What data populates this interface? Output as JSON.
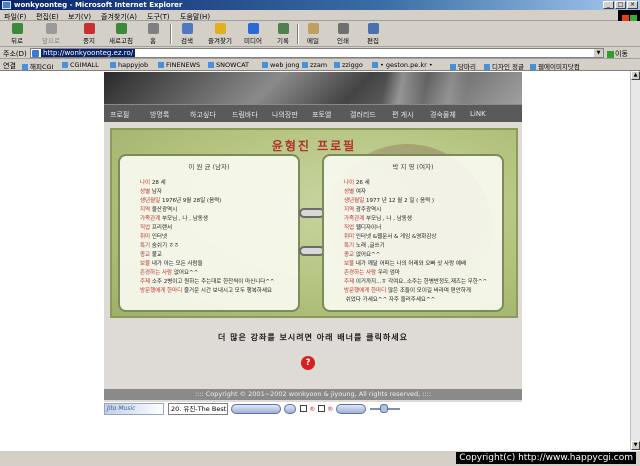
{
  "window": {
    "title": "wonkyoonteg - Microsoft Internet Explorer"
  },
  "menu": [
    "파일(F)",
    "편집(E)",
    "보기(V)",
    "즐겨찾기(A)",
    "도구(T)",
    "도움말(H)"
  ],
  "toolbar": {
    "back": "뒤로",
    "forward": "앞으로",
    "stop": "중지",
    "refresh": "새로고침",
    "home": "홈",
    "search": "검색",
    "favorites": "즐겨찾기",
    "media": "미디어",
    "history": "기록",
    "mail": "메일",
    "print": "인쇄",
    "edit": "편집"
  },
  "address": {
    "label": "주소(D)",
    "url": "http://wonkyoonteg.ez.ro/",
    "go": "이동"
  },
  "links": {
    "label": "연결",
    "items": [
      "해피CGI",
      "CGIMALL",
      "happyjob",
      "FINENEWS",
      "SNOWCAT",
      "web jong",
      "zzam",
      "zziggo",
      "• geston.pe.kr •",
      "당마리",
      "디자인 정글",
      "웹에이미지닷컴"
    ]
  },
  "site": {
    "nav": [
      "프로필",
      "방명록",
      "하고싶다",
      "드림바다",
      "나의장판",
      "포토앨",
      "갤러리드",
      "편 게시",
      "경숙물체",
      "LiNK"
    ],
    "profile_title": "윤형진 프로필",
    "left_name": "이 원 균 (남자)",
    "right_name": "박 지 영 (여자)",
    "left_rows": [
      {
        "k": "나이",
        "v": "28 세"
      },
      {
        "k": "성별",
        "v": "남자"
      },
      {
        "k": "생년월일",
        "v": "1976년 9월 28일 (음력)"
      },
      {
        "k": "지역",
        "v": "울산광역시"
      },
      {
        "k": "가족관계",
        "v": "부모님 , 나 , 남동생"
      },
      {
        "k": "직업",
        "v": "프리랜서"
      },
      {
        "k": "취미",
        "v": "인터넷"
      },
      {
        "k": "특기",
        "v": "숨쉬기 ㅎㅎ"
      },
      {
        "k": "종교",
        "v": "불교"
      },
      {
        "k": "보물",
        "v": "내가 아는 모든 사람들"
      },
      {
        "k": "존경하는 사람",
        "v": "없어요^^"
      },
      {
        "k": "주제",
        "v": "소주 2병이고 원하는 주는대로 한잔씩이 마신니다^^"
      },
      {
        "k": "방문했에게 한마디",
        "v": "즐거운 시간 보내시고 모두 행복하세요"
      }
    ],
    "right_rows": [
      {
        "k": "나이",
        "v": "26 세"
      },
      {
        "k": "성별",
        "v": "여자"
      },
      {
        "k": "생년월일",
        "v": "1977 년 12 월 2 일 ( 음력 )"
      },
      {
        "k": "지역",
        "v": "광주광역시"
      },
      {
        "k": "가족관계",
        "v": "부모님 , 나 , 남동생"
      },
      {
        "k": "직업",
        "v": "웹디자이너"
      },
      {
        "k": "취미",
        "v": "인터넷 &웹문서 & 게임 &영화감상"
      },
      {
        "k": "특기",
        "v": "노래 ,글쓰기"
      },
      {
        "k": "종교",
        "v": "없어요^^"
      },
      {
        "k": "보물",
        "v": "내가 깨달 어떠는 나의 어레와 오빠 삿 사랑 예배"
      },
      {
        "k": "존경하는 사람",
        "v": "우리 엄마"
      },
      {
        "k": "주제",
        "v": "이거까지...ㅎ 각여요..소주는 한병반정도,재즈는 무한^^"
      },
      {
        "k": "방문했에게 한마디",
        "v": "많은 조들이 모이길 바라며 편안하게"
      },
      {
        "k": "",
        "v": "쉬었다 가세요^^ 자주 들러주세요^^"
      }
    ],
    "notice": "더 많은 강좌를 보시려면 아래 배너를 클릭하세요",
    "help": "?",
    "copyright": ":::: Copyright © 2001~2002 wonkyoon & jiyoung, All rights reserved, ::::"
  },
  "player": {
    "logo": "Jito Music",
    "song": "20. 유진-The Best"
  },
  "watermark": "Copyright(c) http://www.happycgi.com"
}
